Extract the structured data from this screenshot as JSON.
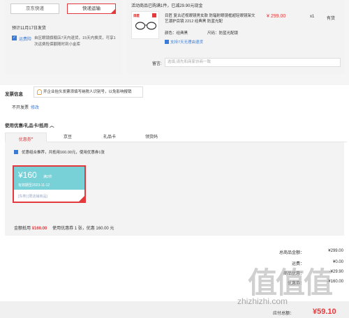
{
  "shipping": {
    "options": [
      "京东快递",
      "快递运输"
    ],
    "selected": "快递运输",
    "delivery_date": "预计11月17日发货",
    "service_label": "运费险",
    "service_desc": "自区眼镜旗舰店7天内退货，15天内换货，可享1次运费险保额随时到小金库"
  },
  "order": {
    "promo_title": "活动商品已购满1件，已减29.90元现金",
    "brand": "目匠",
    "product_name": "目匠 复古近视眼镜男女款 防辐射眼镜框超轻眼镜架文艺潮护目镜 2212 经典黑 防蓝光配",
    "color_label": "颜色：",
    "color_value": "经典黑",
    "lens_label": "尺码：",
    "lens_value": "防蓝光配镜",
    "return_text": "支持7天无理由退货",
    "price": "¥ 299.00",
    "qty": "x1",
    "stock": "有货",
    "remark_label": "留言:",
    "remark_placeholder": "选填,请先和商家协商一致"
  },
  "invoice": {
    "title": "发票信息",
    "tip": "开企业抬头发票须填写纳税人识别号，以免影响报销",
    "status": "不开发票",
    "edit": "修改"
  },
  "coupons": {
    "section_title": "使用优惠/礼品卡/抵用",
    "tabs": [
      "优惠券",
      "京豆",
      "礼品卡",
      "领货码"
    ],
    "active_tab": "优惠券",
    "combo_text": "优惠组合推荐，共抵用160.00元，使用优惠券1张",
    "coupon_amount": "¥160",
    "coupon_cond": "满2件",
    "coupon_date": "有效期至2023-11-12",
    "coupon_limit": "[东券] [限店铺商品]",
    "summary_label": "金额抵用",
    "summary_amount": "¥160.00",
    "summary_rest": "使用优惠券 1 张，优惠 160.00 元"
  },
  "totals": {
    "rows": [
      {
        "label": "总商品金额：",
        "value": "¥299.00"
      },
      {
        "label": "运费：",
        "value": "¥0.00"
      },
      {
        "label": "商品优惠：",
        "value": "-¥29.90"
      },
      {
        "label": "优惠券：",
        "value": "-¥160.00"
      }
    ],
    "pay_label": "应付总额：",
    "pay_value": "¥59.10"
  },
  "watermark": {
    "logo": "值值值",
    "url": "zhizhizhi.com"
  },
  "colors": {
    "accent": "#e4393c",
    "link": "#3a7bd5",
    "coupon_bg": "#78d1d7"
  }
}
